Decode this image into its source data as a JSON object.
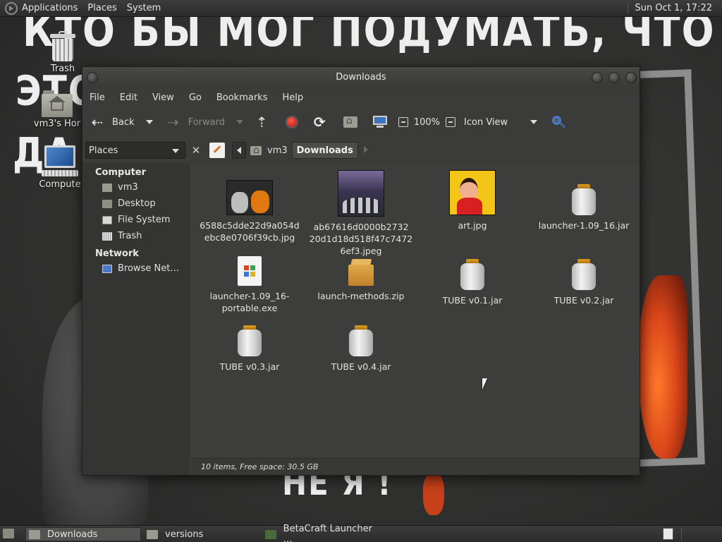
{
  "wallpaper": {
    "line1": "КТО БЫ МОГ ПОДУМАТЬ, ЧТО Я –",
    "line2": "ЭТО",
    "line3": "ДА",
    "line4": "НЕ Я !"
  },
  "top_panel": {
    "menus": [
      "Applications",
      "Places",
      "System"
    ],
    "clock": "Sun Oct 1, 17:22"
  },
  "desktop_icons": [
    {
      "label": "Trash",
      "icon": "trash-icon"
    },
    {
      "label": "vm3's Hor",
      "icon": "home-folder-icon"
    },
    {
      "label": "Compute",
      "icon": "computer-icon"
    }
  ],
  "window": {
    "title": "Downloads",
    "menu": [
      "File",
      "Edit",
      "View",
      "Go",
      "Bookmarks",
      "Help"
    ],
    "toolbar": {
      "back": "Back",
      "forward": "Forward",
      "zoom": "100%",
      "view_mode": "Icon View"
    },
    "places_label": "Places",
    "breadcrumbs": [
      "vm3",
      "Downloads"
    ],
    "sidebar": {
      "sections": [
        {
          "title": "Computer",
          "items": [
            {
              "label": "vm3",
              "icon": "home-icon"
            },
            {
              "label": "Desktop",
              "icon": "desktop-icon"
            },
            {
              "label": "File System",
              "icon": "filesystem-icon"
            },
            {
              "label": "Trash",
              "icon": "trash-icon"
            }
          ]
        },
        {
          "title": "Network",
          "items": [
            {
              "label": "Browse Net…",
              "icon": "network-icon"
            }
          ]
        }
      ]
    },
    "files": [
      {
        "name": "6588c5dde22d9a054d ebc8e0706f39cb.jpg",
        "type": "image"
      },
      {
        "name": "ab67616d0000b2732 20d1d18d518f47c7472 6ef3.jpeg",
        "type": "image"
      },
      {
        "name": "art.jpg",
        "type": "image"
      },
      {
        "name": "launcher-1.09_16.jar",
        "type": "jar"
      },
      {
        "name": "launcher-1.09_16- portable.exe",
        "type": "exe"
      },
      {
        "name": "launch-methods.zip",
        "type": "zip"
      },
      {
        "name": "TUBE v0.1.jar",
        "type": "jar"
      },
      {
        "name": "TUBE v0.2.jar",
        "type": "jar"
      },
      {
        "name": "TUBE v0.3.jar",
        "type": "jar"
      },
      {
        "name": "TUBE v0.4.jar",
        "type": "jar"
      }
    ],
    "status": "10 items, Free space: 30.5 GB"
  },
  "taskbar": [
    {
      "label": "Downloads",
      "active": true
    },
    {
      "label": "versions",
      "active": false
    },
    {
      "label": "BetaCraft Launcher …",
      "active": false
    }
  ]
}
